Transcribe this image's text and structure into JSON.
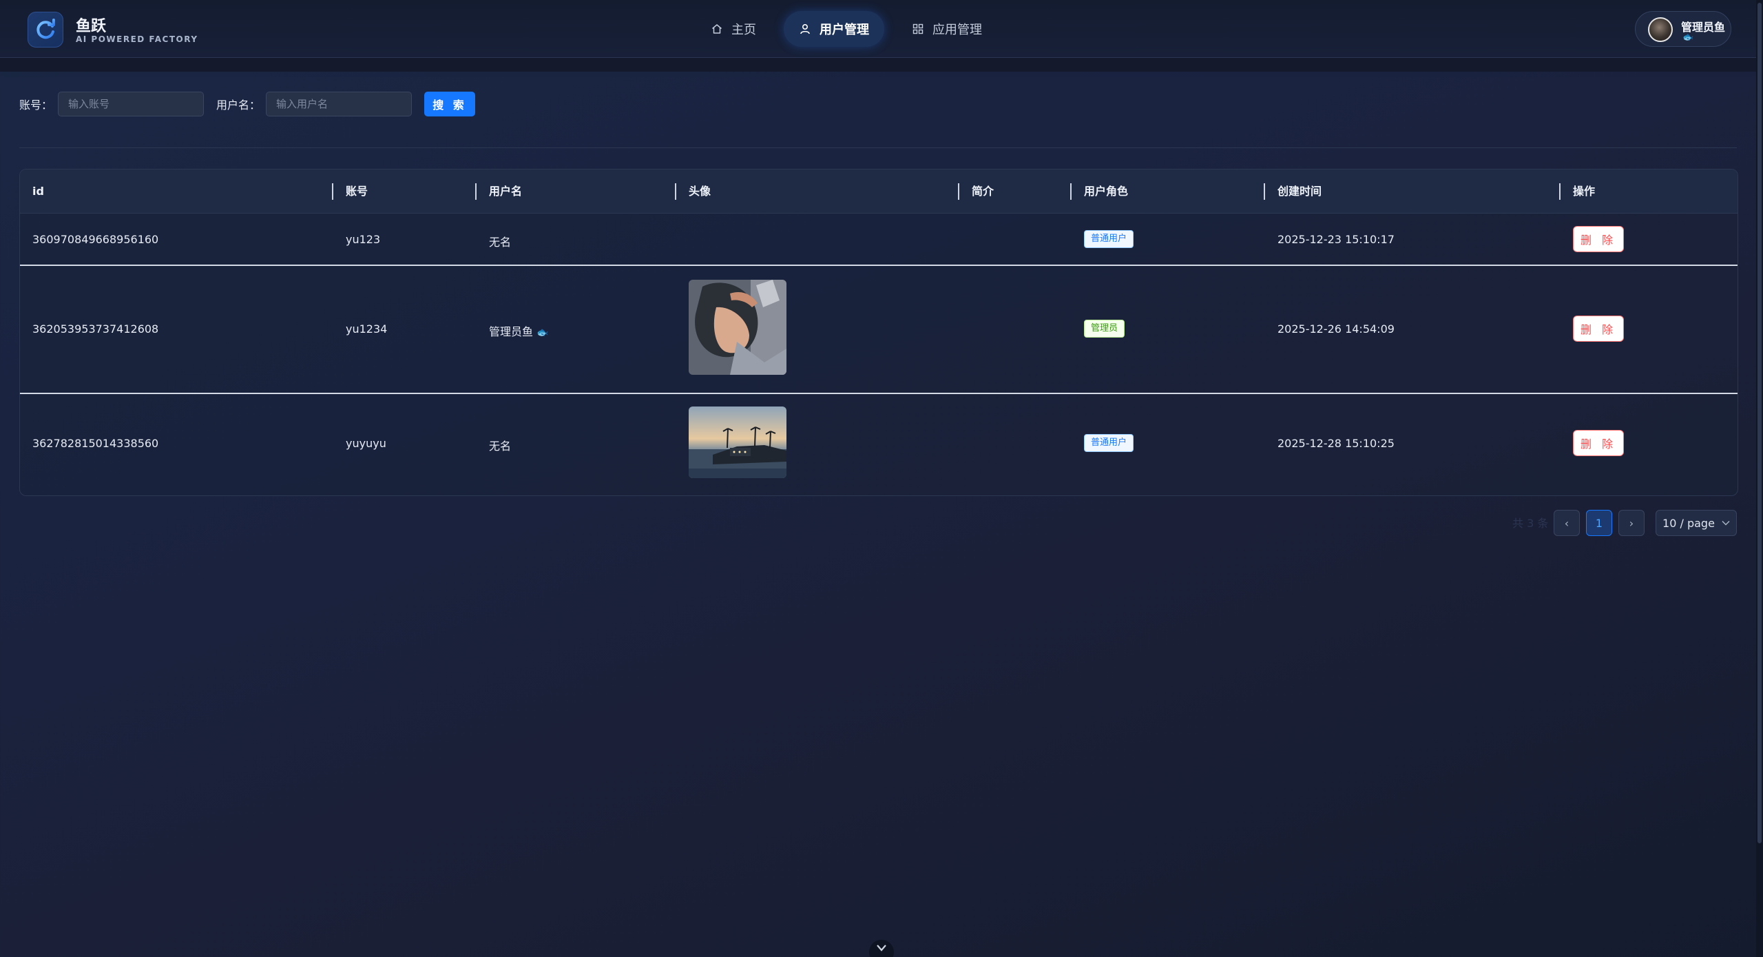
{
  "brand": {
    "name": "鱼跃",
    "subtitle": "AI POWERED FACTORY"
  },
  "nav": {
    "items": [
      {
        "label": "主页",
        "icon": "home-icon",
        "active": false
      },
      {
        "label": "用户管理",
        "icon": "user-icon",
        "active": true
      },
      {
        "label": "应用管理",
        "icon": "apps-grid-icon",
        "active": false
      }
    ]
  },
  "user": {
    "name": "管理员鱼",
    "badge": "🐟"
  },
  "search": {
    "account_label": "账号：",
    "account_placeholder": "输入账号",
    "username_label": "用户名：",
    "username_placeholder": "输入用户名",
    "button_label": "搜 索"
  },
  "table": {
    "columns": [
      "id",
      "账号",
      "用户名",
      "头像",
      "简介",
      "用户角色",
      "创建时间",
      "操作"
    ],
    "rows": [
      {
        "id": "360970849668956160",
        "account": "yu123",
        "username": "无名",
        "name_badge": "",
        "avatar": "none",
        "intro": "",
        "role": "普通用户",
        "created": "2025-12-23 15:10:17",
        "action": "删 除"
      },
      {
        "id": "362053953737412608",
        "account": "yu1234",
        "username": "管理员鱼",
        "name_badge": "🐟",
        "avatar": "anime-portrait",
        "intro": "",
        "role": "管理员",
        "created": "2025-12-26 14:54:09",
        "action": "删 除"
      },
      {
        "id": "362782815014338560",
        "account": "yuyuyu",
        "username": "无名",
        "name_badge": "",
        "avatar": "coastal-sunset",
        "intro": "",
        "role": "普通用户",
        "created": "2025-12-28 15:10:25",
        "action": "删 除"
      }
    ]
  },
  "pagination": {
    "total_text": "共 3 条",
    "current_page": "1",
    "prev": "‹",
    "next": "›",
    "page_size": "10 / page"
  },
  "colors": {
    "primary": "#1677ff",
    "danger": "#ff4d4f",
    "admin_tag": "#389e0d",
    "background": "#1a2340"
  }
}
